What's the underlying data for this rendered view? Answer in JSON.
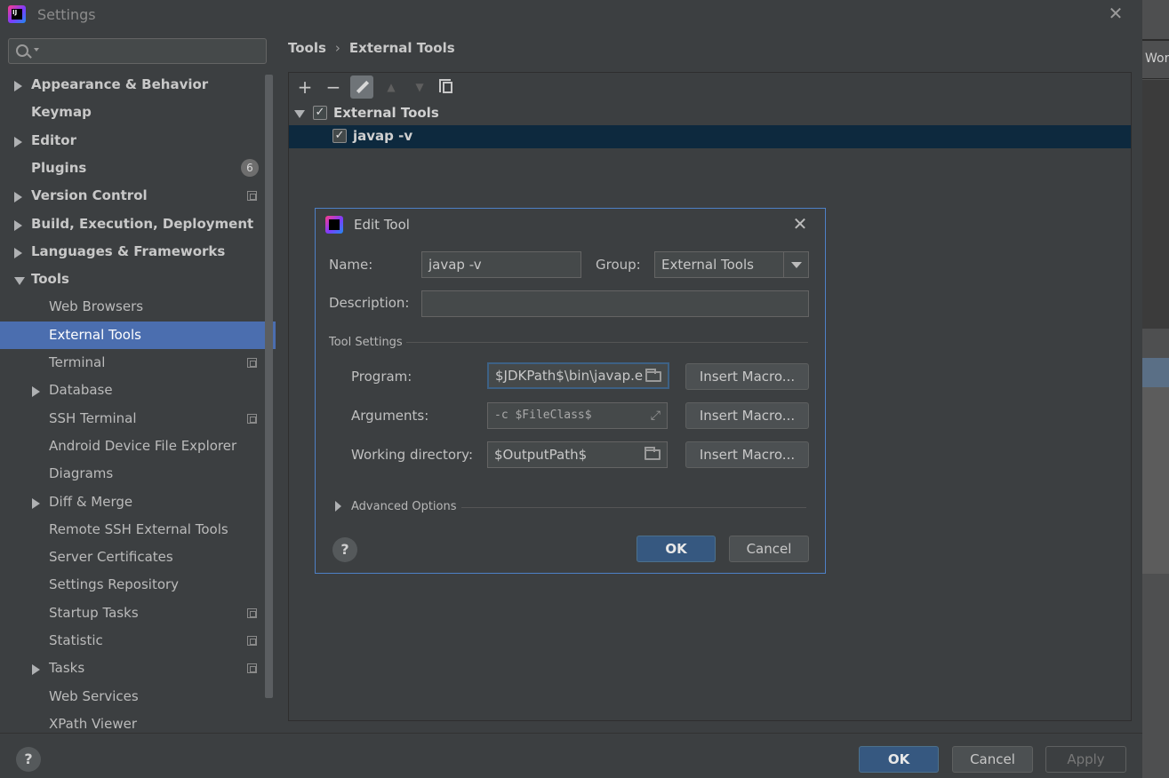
{
  "window": {
    "title": "Settings",
    "close_glyph": "✕"
  },
  "search": {
    "placeholder": "",
    "value": ""
  },
  "sidebar": {
    "items": [
      {
        "label": "Appearance & Behavior",
        "bold": true,
        "arrow": "right"
      },
      {
        "label": "Keymap",
        "bold": true
      },
      {
        "label": "Editor",
        "bold": true,
        "arrow": "right"
      },
      {
        "label": "Plugins",
        "bold": true,
        "badge": "6"
      },
      {
        "label": "Version Control",
        "bold": true,
        "arrow": "right",
        "project_icon": true
      },
      {
        "label": "Build, Execution, Deployment",
        "bold": true,
        "arrow": "right"
      },
      {
        "label": "Languages & Frameworks",
        "bold": true,
        "arrow": "right"
      },
      {
        "label": "Tools",
        "bold": true,
        "arrow": "down"
      },
      {
        "label": "Web Browsers"
      },
      {
        "label": "External Tools",
        "selected": true
      },
      {
        "label": "Terminal",
        "project_icon": true
      },
      {
        "label": "Database",
        "arrow": "right"
      },
      {
        "label": "SSH Terminal",
        "project_icon": true
      },
      {
        "label": "Android Device File Explorer"
      },
      {
        "label": "Diagrams"
      },
      {
        "label": "Diff & Merge",
        "arrow": "right"
      },
      {
        "label": "Remote SSH External Tools"
      },
      {
        "label": "Server Certificates"
      },
      {
        "label": "Settings Repository"
      },
      {
        "label": "Startup Tasks",
        "project_icon": true
      },
      {
        "label": "Statistic",
        "project_icon": true
      },
      {
        "label": "Tasks",
        "arrow": "right",
        "project_icon": true
      },
      {
        "label": "Web Services"
      },
      {
        "label": "XPath Viewer"
      }
    ]
  },
  "breadcrumb": {
    "parent": "Tools",
    "separator": "›",
    "current": "External Tools"
  },
  "toolbar": {
    "add": "+",
    "remove": "−",
    "move_up": "▲",
    "move_down": "▼"
  },
  "tools_tree": {
    "group": {
      "label": "External Tools",
      "checked": "✓"
    },
    "tool": {
      "label": "javap -v",
      "checked": "✓"
    }
  },
  "edit_dialog": {
    "title": "Edit Tool",
    "close_glyph": "✕",
    "name_label": "Name:",
    "name_value": "javap -v",
    "group_label": "Group:",
    "group_value": "External Tools",
    "description_label": "Description:",
    "description_value": "",
    "tool_settings_title": "Tool Settings",
    "program_label": "Program:",
    "program_value": "$JDKPath$\\bin\\javap.e",
    "arguments_label": "Arguments:",
    "arguments_value": "-c $FileClass$",
    "workdir_label": "Working directory:",
    "workdir_value": "$OutputPath$",
    "insert_macro_label": "Insert Macro...",
    "advanced_label": "Advanced Options",
    "ok_label": "OK",
    "cancel_label": "Cancel",
    "help_glyph": "?"
  },
  "footer": {
    "help_glyph": "?",
    "ok_label": "OK",
    "cancel_label": "Cancel",
    "apply_label": "Apply"
  },
  "background_app": {
    "partial_text": "Wor"
  },
  "colors": {
    "accent": "#4b6eaf",
    "primary_button": "#365880",
    "selection_dark": "#0d293e",
    "dialog_border": "#4e80c6"
  }
}
